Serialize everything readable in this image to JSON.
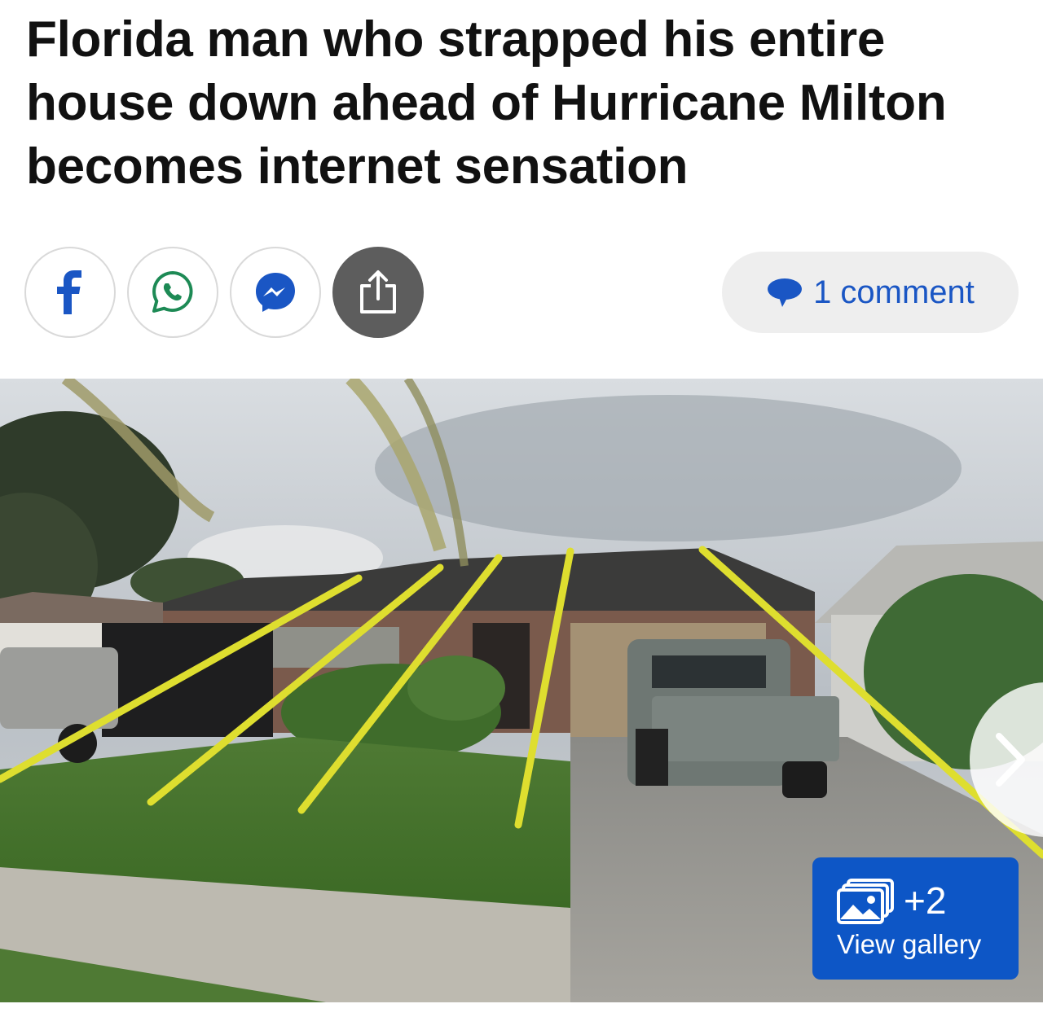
{
  "article": {
    "headline": "Florida man who strapped his entire house down ahead of Hurricane Milton becomes internet sensation"
  },
  "share": {
    "buttons": [
      {
        "name": "facebook",
        "icon": "facebook-icon",
        "color": "#1a56c4"
      },
      {
        "name": "whatsapp",
        "icon": "whatsapp-icon",
        "color": "#1d8a55"
      },
      {
        "name": "messenger",
        "icon": "messenger-icon",
        "color": "#1a56c4"
      },
      {
        "name": "more",
        "icon": "share-icon",
        "color": "#5d5d5d"
      }
    ]
  },
  "comments": {
    "label": "1 comment",
    "icon": "speech-bubble-icon",
    "color": "#1a56c4"
  },
  "gallery": {
    "count": "+2",
    "label": "View gallery",
    "icon": "photos-icon",
    "color": "#0d56c6"
  },
  "image": {
    "icon": "chevron-right-icon"
  }
}
